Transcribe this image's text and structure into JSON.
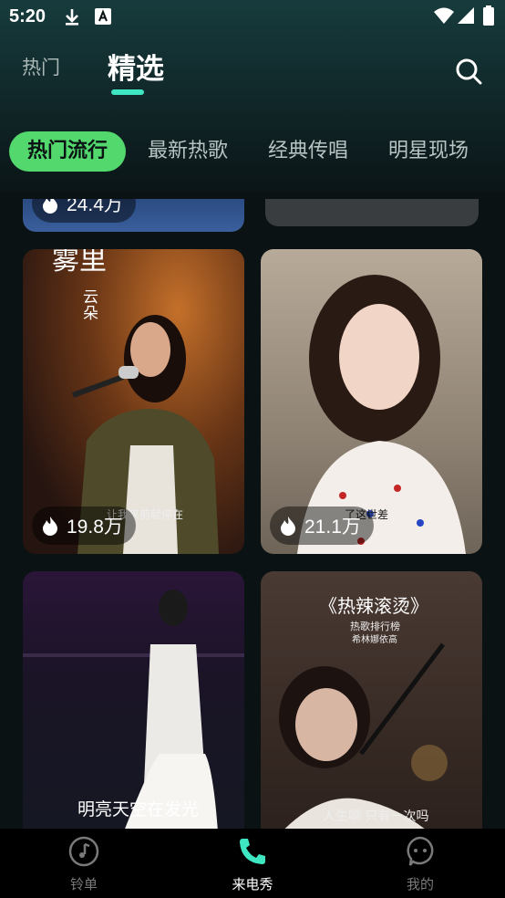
{
  "status": {
    "time": "5:20"
  },
  "top_tabs": [
    {
      "label": "热门"
    },
    {
      "label": "精选"
    }
  ],
  "chips": [
    "热门流行",
    "最新热歌",
    "经典传唱",
    "明星现场"
  ],
  "cards": [
    {
      "plays": "24.4万"
    },
    {
      "plays": ""
    },
    {
      "plays": "19.8万",
      "title_big": "雾里",
      "title_small": "云朵",
      "subtitle": "让我来剪就停在"
    },
    {
      "plays": "21.1万",
      "subtitle": "了这世差"
    },
    {
      "caption": "明亮天空在发光"
    },
    {
      "title": "《热辣滚烫》",
      "line1": "热歌排行榜",
      "line2": "希林娜依高",
      "caption": "人生啊 只有一次吗"
    }
  ],
  "nav": [
    {
      "label": "铃单"
    },
    {
      "label": "来电秀"
    },
    {
      "label": "我的"
    }
  ],
  "colors": {
    "accent": "#3ee6c2",
    "chip_active": "#52d86c",
    "nav_active": "#3ee6c2"
  }
}
